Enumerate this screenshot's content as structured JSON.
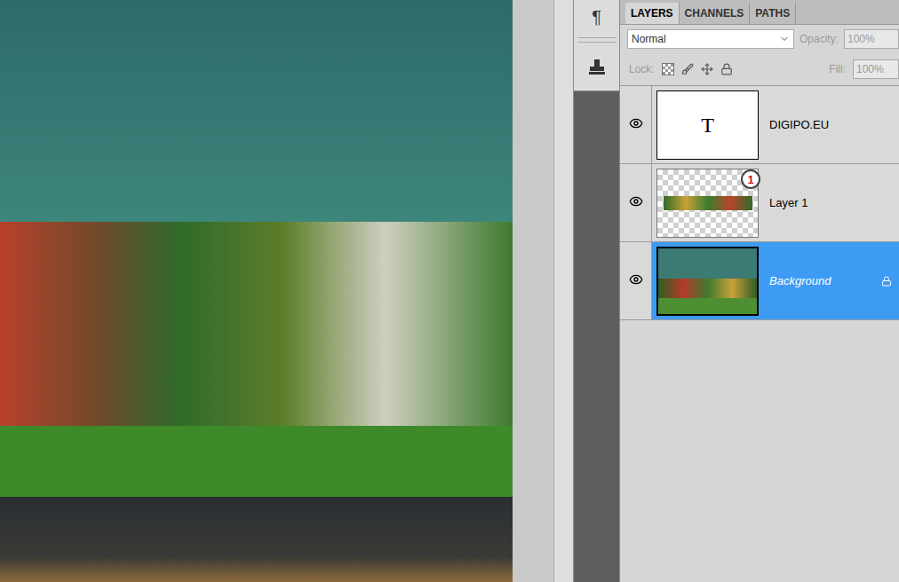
{
  "dock": {
    "buttons": [
      "¶"
    ]
  },
  "panel": {
    "tabs": [
      {
        "label": "LAYERS",
        "selected": true
      },
      {
        "label": "CHANNELS",
        "selected": false
      },
      {
        "label": "PATHS",
        "selected": false
      }
    ],
    "blend_mode": "Normal",
    "opacity_label": "Opacity:",
    "opacity": "100%",
    "lock_label": "Lock:",
    "fill_label": "Fill:",
    "fill": "100%"
  },
  "layers": [
    {
      "name": "DIGIPO.EU",
      "kind": "text",
      "thumb": "T",
      "visible": true,
      "selected": false,
      "locked": false,
      "italic": false,
      "badge": ""
    },
    {
      "name": "Layer 1",
      "kind": "image",
      "thumb": "",
      "visible": true,
      "selected": false,
      "locked": false,
      "italic": false,
      "badge": "1"
    },
    {
      "name": "Background",
      "kind": "photo",
      "thumb": "",
      "visible": true,
      "selected": true,
      "locked": true,
      "italic": true,
      "badge": ""
    }
  ]
}
